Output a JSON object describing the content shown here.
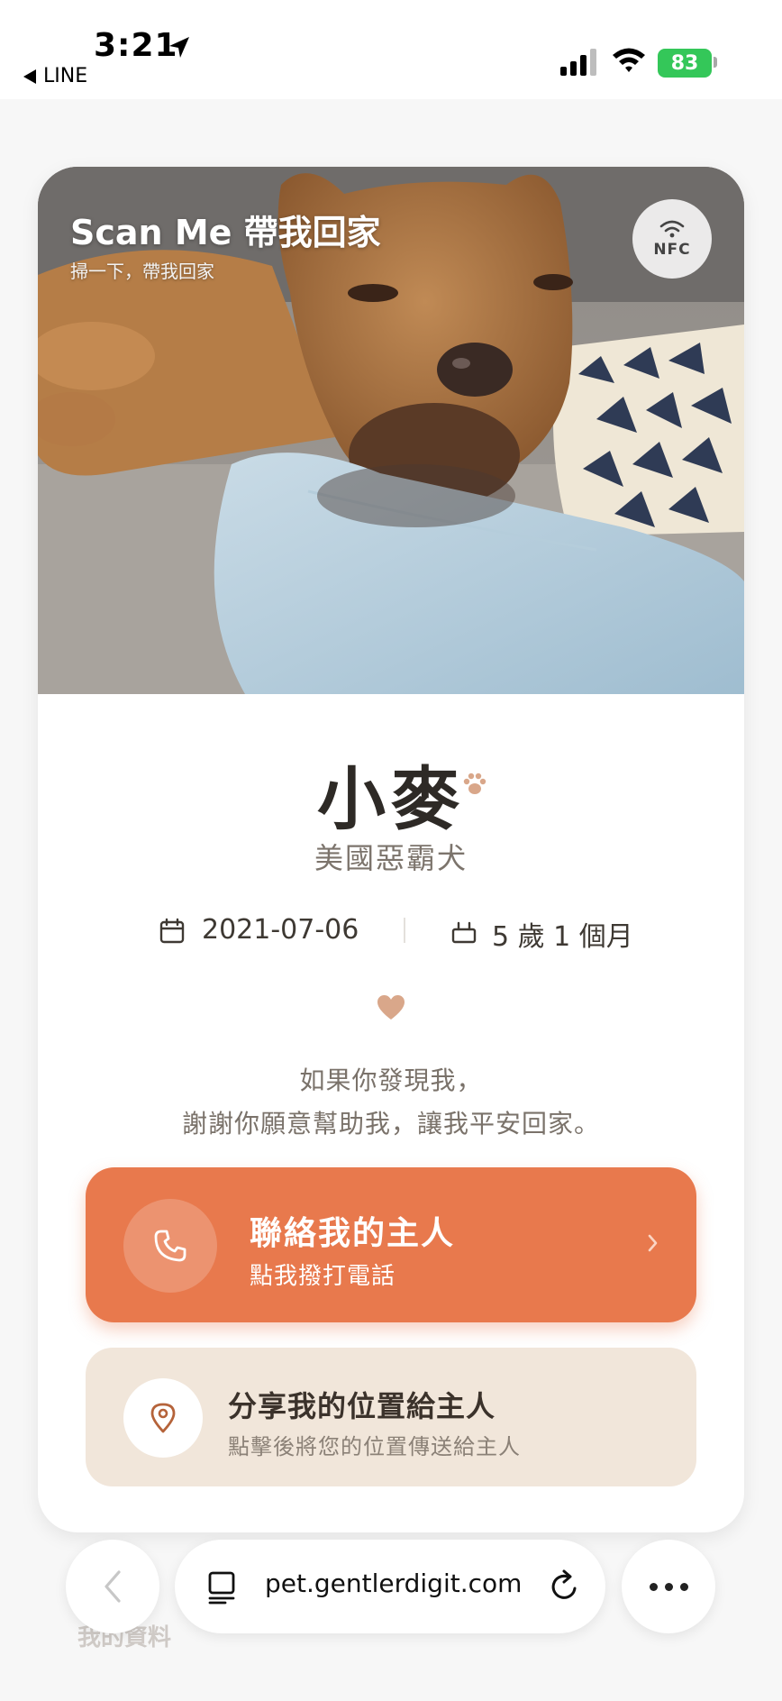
{
  "status_bar": {
    "time": "3:21",
    "back_app": "LINE",
    "battery": "83"
  },
  "hero": {
    "title": "Scan Me 帶我回家",
    "subtitle": "掃一下，帶我回家",
    "nfc_label": "NFC"
  },
  "pet": {
    "name": "小麥",
    "breed": "美國惡霸犬",
    "birthdate": "2021-07-06",
    "age": "5 歲 1 個月"
  },
  "message": {
    "line1": "如果你發現我，",
    "line2": "謝謝你願意幫助我，讓我平安回家。"
  },
  "call_button": {
    "title": "聯絡我的主人",
    "subtitle": "點我撥打電話"
  },
  "location_button": {
    "title": "分享我的位置給主人",
    "subtitle": "點擊後將您的位置傳送給主人"
  },
  "browser": {
    "url": "pet.gentlerdigit.com",
    "faded_label": "我的資料"
  },
  "colors": {
    "accent": "#e8794d",
    "secondary": "#f1e6da",
    "heart": "#d9a78a",
    "battery": "#34c759"
  }
}
